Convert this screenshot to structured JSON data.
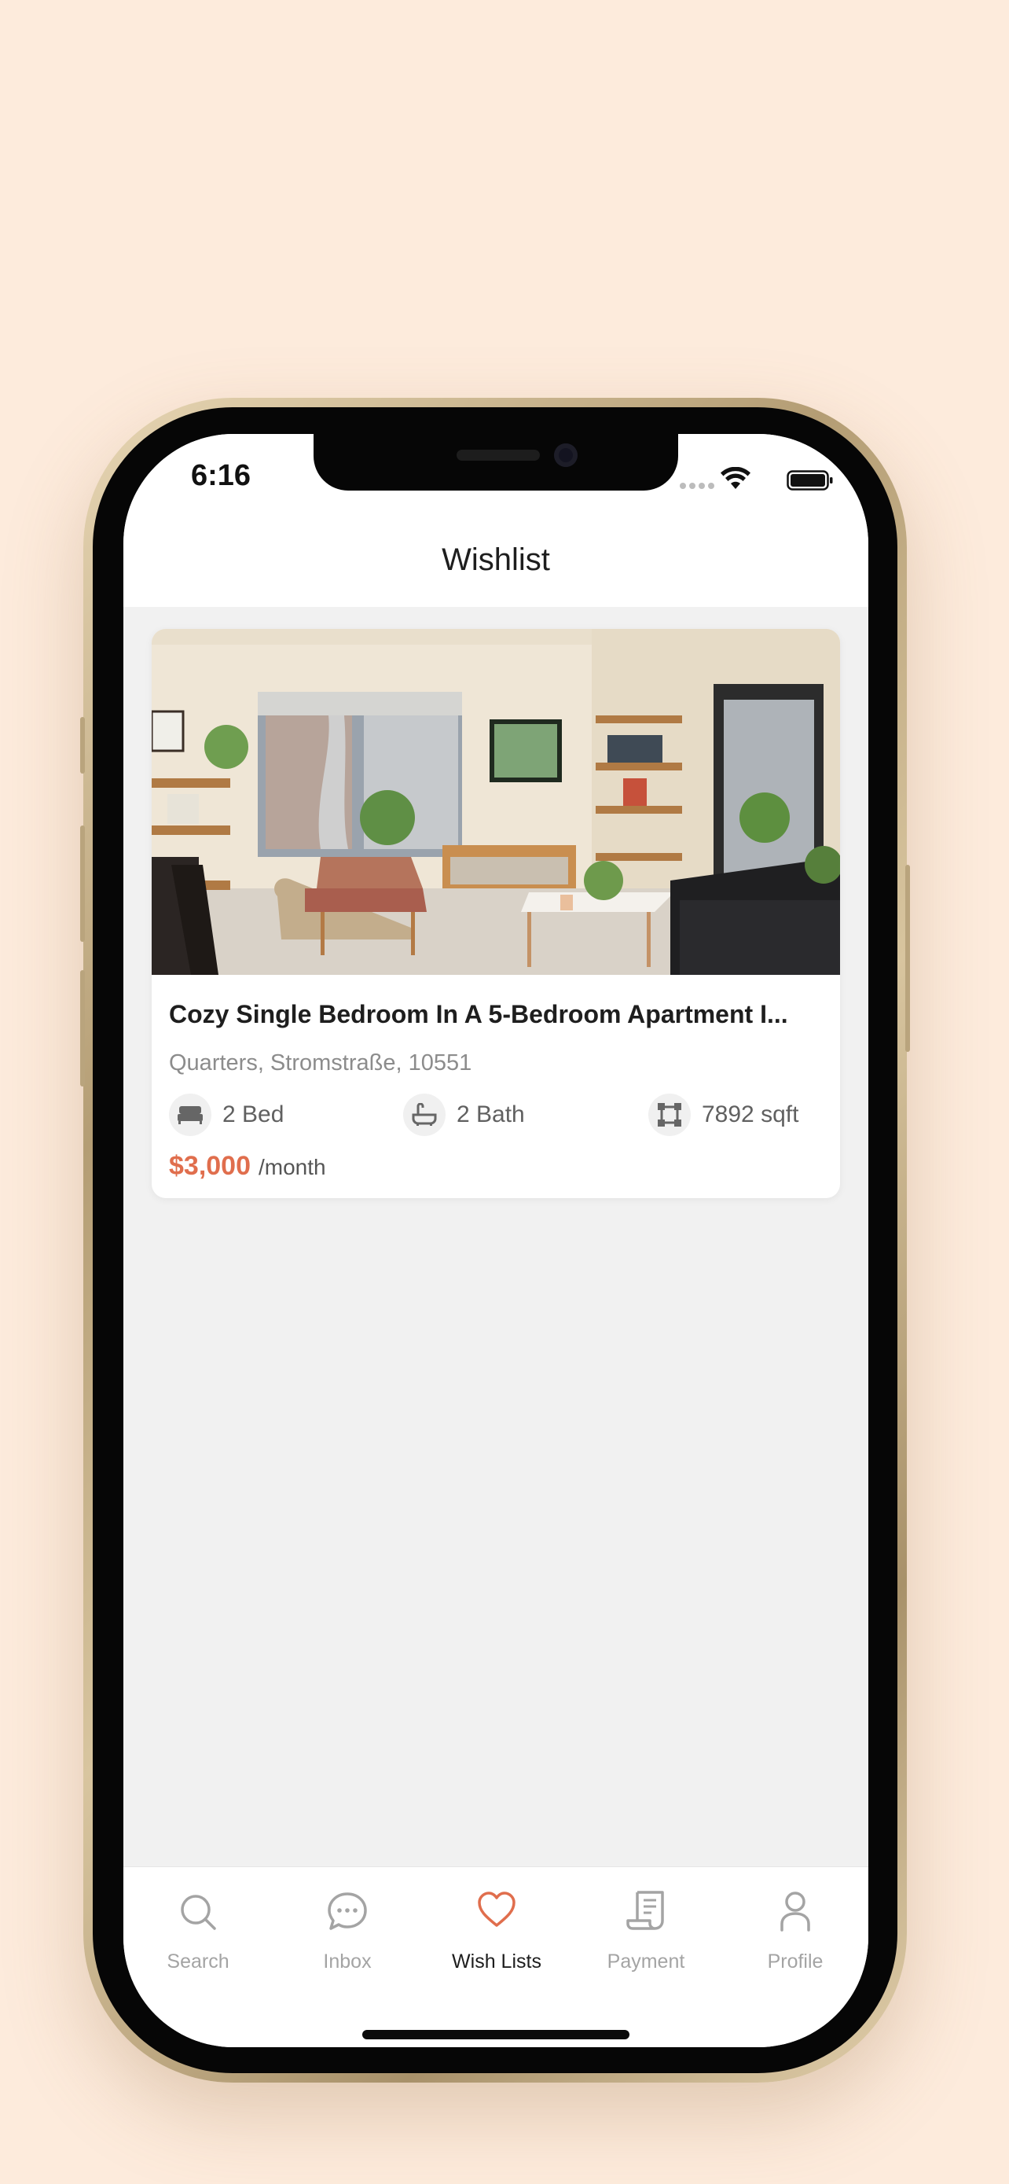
{
  "colors": {
    "background": "#fdebdc",
    "accent": "#e06e4d",
    "inactive": "#a4a4a4"
  },
  "status_bar": {
    "time": "6:16"
  },
  "header": {
    "title": "Wishlist"
  },
  "listings": [
    {
      "title": "Cozy Single Bedroom In A 5-Bedroom Apartment I...",
      "address": "Quarters, Stromstraße, 10551",
      "amenities": [
        {
          "icon": "bed-icon",
          "label": "2 Bed"
        },
        {
          "icon": "bathtub-icon",
          "label": "2 Bath"
        },
        {
          "icon": "area-icon",
          "label": "7892 sqft"
        }
      ],
      "price": "$3,000",
      "price_unit": "/month"
    }
  ],
  "tabbar": {
    "tabs": [
      {
        "label": "Search",
        "icon": "search-icon",
        "active": false
      },
      {
        "label": "Inbox",
        "icon": "chat-bubble-icon",
        "active": false
      },
      {
        "label": "Wish Lists",
        "icon": "heart-icon",
        "active": true
      },
      {
        "label": "Payment",
        "icon": "receipt-icon",
        "active": false
      },
      {
        "label": "Profile",
        "icon": "person-icon",
        "active": false
      }
    ]
  }
}
